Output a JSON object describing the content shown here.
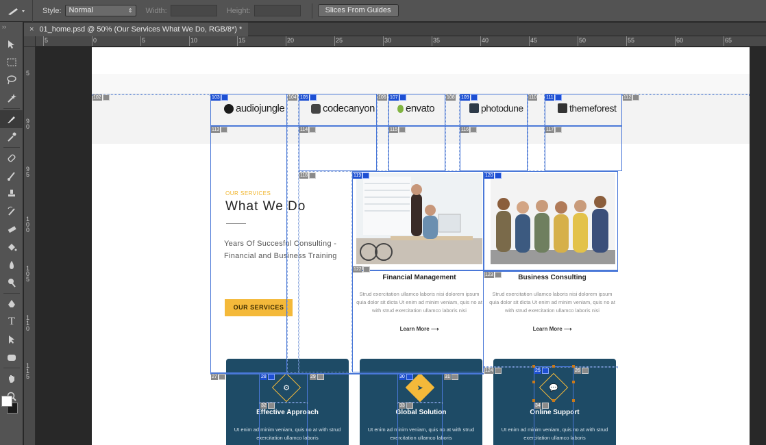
{
  "options_bar": {
    "style_label": "Style:",
    "style_value": "Normal",
    "width_label": "Width:",
    "height_label": "Height:",
    "slices_button": "Slices From Guides"
  },
  "tab": {
    "close": "×",
    "title": "01_home.psd @ 50% (Our Services What We Do, RGB/8*) *"
  },
  "rulers": {
    "h_ticks": [
      "5",
      "0",
      "5",
      "10",
      "15",
      "20",
      "25",
      "30",
      "35",
      "40",
      "45",
      "50",
      "55",
      "60",
      "65"
    ],
    "v_ticks": [
      "5",
      "9 0",
      "9 5",
      "1 0 0",
      "1 0 5",
      "1 1 0",
      "1 1 5"
    ]
  },
  "brands": [
    "audiojungle",
    "codecanyon",
    "envato",
    "photodune",
    "themeforest"
  ],
  "services": {
    "kicker": "OUR SERVICES",
    "title": "What We Do",
    "lead": "Years Of Succesful Consulting - Financial and Business Training",
    "cta": "OUR SERVICES",
    "items": [
      {
        "title": "Financial Management",
        "desc": "Strud exercitation ullamco laboris nisi dolorem ipsum quia dolor sit dicta Ut enim ad minim veniam, quis no at with strud exercitation ullamco laboris nisi",
        "link": "Learn More ⟶"
      },
      {
        "title": "Business Consulting",
        "desc": "Strud exercitation ullamco laboris nisi dolorem ipsum quia dolor sit dicta Ut enim ad minim veniam, quis no at with strud exercitation ullamco laboris nisi",
        "link": "Learn More ⟶"
      }
    ]
  },
  "cards": [
    {
      "title": "Effective Approach",
      "desc": "Ut enim ad minim veniam, quis no at with strud exercitation ullamco laboris"
    },
    {
      "title": "Global Solution",
      "desc": "Ut enim ad minim veniam, quis no at with strud exercitation ullamco laboris"
    },
    {
      "title": "Online Support",
      "desc": "Ut enim ad minim veniam, quis no at with strud exercitation ullamco laboris"
    }
  ],
  "slice_numbers": {
    "s102": "102",
    "s103": "103",
    "s104": "104",
    "s105": "105",
    "s106": "106",
    "s107": "107",
    "s108": "108",
    "s109": "109",
    "s110": "110",
    "s111": "111",
    "s112": "112",
    "s113": "113",
    "s114": "114",
    "s115": "115",
    "s116": "116",
    "s117": "117",
    "s118": "118",
    "s119": "119",
    "s120": "120",
    "s122": "122",
    "s123": "123",
    "s124": "124",
    "s25": "25",
    "s26": "26",
    "s27": "27",
    "s28": "28",
    "s29": "29",
    "s30": "30",
    "s31": "31",
    "s32": "32",
    "s33": "33",
    "s34": "34"
  },
  "colors": {
    "accent_yellow": "#f4b93a",
    "card_teal": "#1e4b66",
    "slice_blue": "#1d4fd2"
  }
}
